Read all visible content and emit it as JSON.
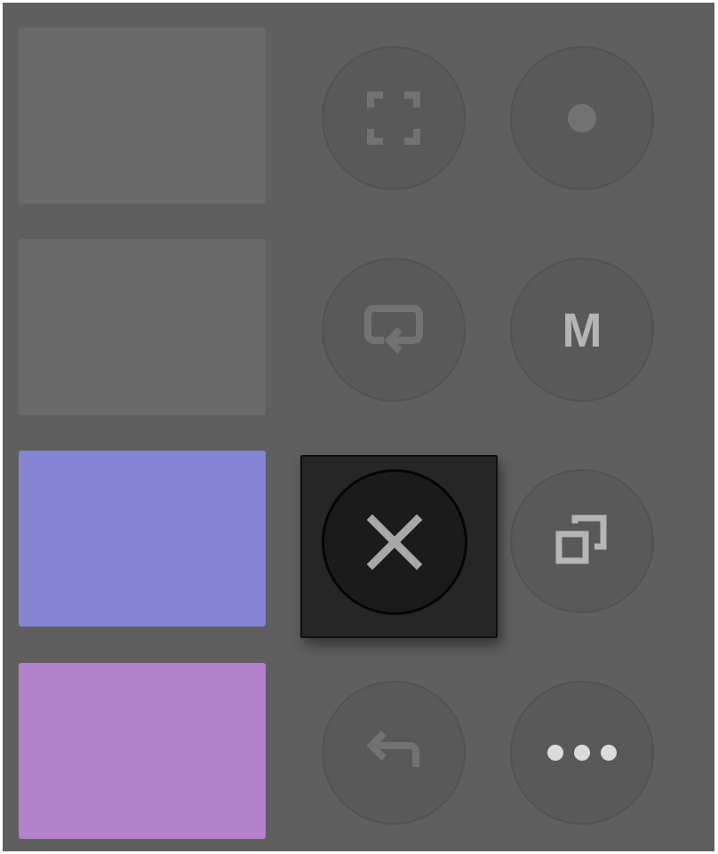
{
  "pads": [
    {
      "name": "pad-1",
      "color": "#6a6a6a"
    },
    {
      "name": "pad-2",
      "color": "#6a6a6a"
    },
    {
      "name": "pad-3",
      "color": "#8585d3"
    },
    {
      "name": "pad-4",
      "color": "#b283ca"
    }
  ],
  "buttons": {
    "capture": {
      "icon": "fullscreen-capture-icon"
    },
    "record": {
      "icon": "record-dot-icon"
    },
    "loop": {
      "icon": "loop-arrow-icon"
    },
    "mute": {
      "icon": "mute-letter-icon",
      "label": "M"
    },
    "duplicate": {
      "icon": "duplicate-icon"
    },
    "undo": {
      "icon": "undo-arrow-icon"
    },
    "more": {
      "icon": "more-dots-icon"
    }
  },
  "popup": {
    "close": {
      "icon": "close-icon"
    }
  },
  "colors": {
    "panel_bg": "#5f5f5f",
    "button_bg": "#595959",
    "icon_dim": "#727272",
    "icon_light": "#b5b5b5",
    "popup_bg": "#262626",
    "close_icon": "#a8a8a8"
  }
}
